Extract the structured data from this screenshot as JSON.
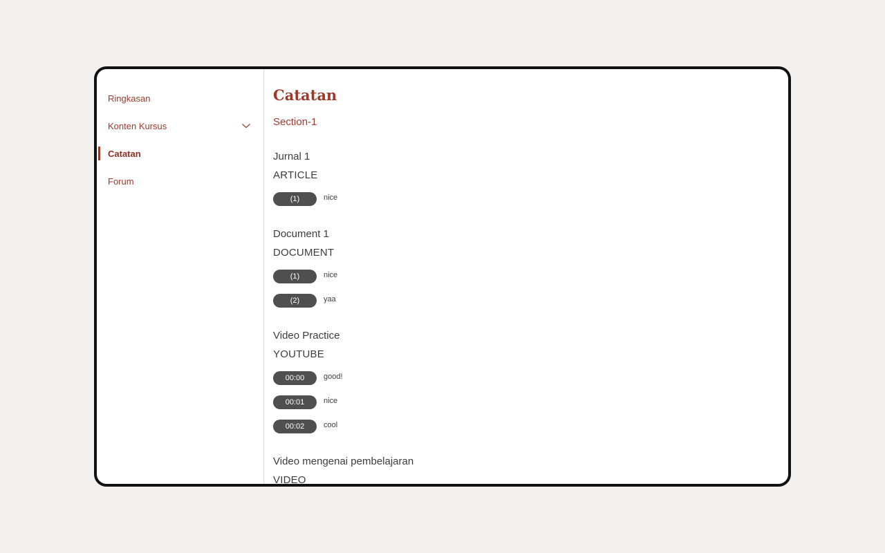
{
  "sidebar": {
    "items": [
      {
        "label": "Ringkasan"
      },
      {
        "label": "Konten Kursus"
      },
      {
        "label": "Catatan"
      },
      {
        "label": "Forum"
      }
    ]
  },
  "main": {
    "title": "Catatan",
    "section": "Section-1",
    "items": [
      {
        "name": "Jurnal 1",
        "type": "ARTICLE",
        "notes": [
          {
            "marker": "(1)",
            "text": "nice"
          }
        ]
      },
      {
        "name": "Document 1",
        "type": "DOCUMENT",
        "notes": [
          {
            "marker": "(1)",
            "text": "nice"
          },
          {
            "marker": "(2)",
            "text": "yaa"
          }
        ]
      },
      {
        "name": "Video Practice",
        "type": "YOUTUBE",
        "notes": [
          {
            "marker": "00:00",
            "text": "good!"
          },
          {
            "marker": "00:01",
            "text": "nice"
          },
          {
            "marker": "00:02",
            "text": "cool"
          }
        ]
      },
      {
        "name": "Video mengenai pembelajaran",
        "type": "VIDEO",
        "notes": []
      }
    ]
  },
  "icons": {
    "expand": "chevron-down-icon"
  },
  "colors": {
    "accent": "#9a3a2a",
    "pill": "#4f4f4f",
    "background": "#f2f1ef"
  }
}
